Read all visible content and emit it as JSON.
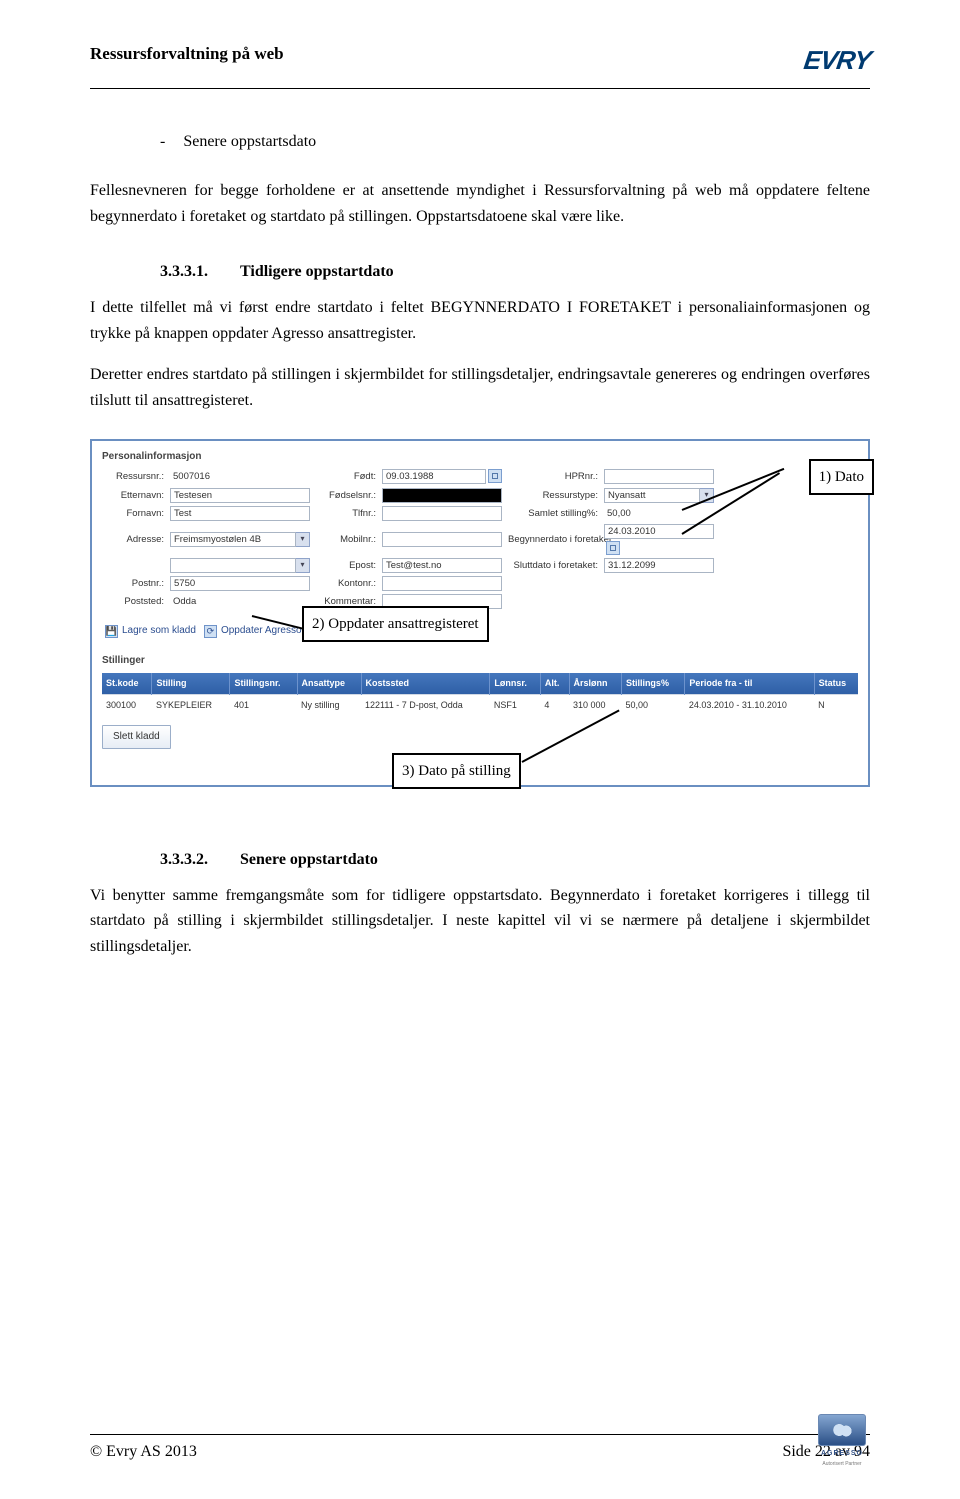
{
  "header": {
    "doc_title": "Ressursforvaltning på web",
    "logo_text": "EVRY"
  },
  "body": {
    "bullet1": "Senere oppstartsdato",
    "para1": "Fellesnevneren for begge forholdene er at ansettende myndighet i Ressursforvaltning på web må oppdatere feltene begynnerdato i foretaket og startdato på stillingen. Oppstartsdatoene skal være like.",
    "sec1_num": "3.3.3.1.",
    "sec1_title": "Tidligere oppstartdato",
    "para2": "I dette tilfellet må vi først endre startdato i feltet BEGYNNERDATO I FORETAKET i personaliainformasjonen og trykke på knappen oppdater Agresso ansattregister.",
    "para3": "Deretter endres startdato på stillingen i skjermbildet for stillingsdetaljer, endringsavtale genereres og endringen overføres tilslutt til ansattregisteret.",
    "sec2_num": "3.3.3.2.",
    "sec2_title": "Senere oppstartdato",
    "para4": "Vi benytter samme fremgangsmåte som for tidligere oppstartsdato. Begynnerdato i foretaket korrigeres i tillegg til startdato på stilling i skjermbildet stillingsdetaljer. I neste kapittel vil vi se nærmere på detaljene i skjermbildet stillingsdetaljer."
  },
  "figure": {
    "section_title": "Personalinformasjon",
    "callout1": "1)  Dato",
    "callout2": "2) Oppdater ansattregisteret",
    "callout3": "3) Dato på stilling",
    "labels": {
      "ressursnr": "Ressursnr.:",
      "etternavn": "Etternavn:",
      "fornavn": "Fornavn:",
      "adresse": "Adresse:",
      "postnr": "Postnr.:",
      "poststed": "Poststed:",
      "fodt": "Født:",
      "fodselsnr": "Fødselsnr.:",
      "tlfnr": "Tlfnr.:",
      "mobilnr": "Mobilnr.:",
      "epost": "Epost:",
      "kontonr": "Kontonr.:",
      "kommentar": "Kommentar:",
      "hprnr": "HPRnr.:",
      "ressurstype": "Ressurstype:",
      "samlet_stilling": "Samlet stilling%:",
      "begynnerdato": "Begynnerdato i foretaket:",
      "sluttdato": "Sluttdato i foretaket:"
    },
    "values": {
      "ressursnr": "5007016",
      "etternavn": "Testesen",
      "fornavn": "Test",
      "adresse": "Freimsmyostølen 4B",
      "postnr": "5750",
      "poststed": "Odda",
      "fodt": "09.03.1988",
      "epost": "Test@test.no",
      "ressurstype": "Nyansatt",
      "samlet_stilling": "50,00",
      "begynnerdato": "24.03.2010",
      "sluttdato": "31.12.2099"
    },
    "actions": {
      "lagre": "Lagre som kladd",
      "oppdater": "Oppdater Agresso ansattregister",
      "slett": "Slett kladd"
    },
    "stillinger_title": "Stillinger",
    "table": {
      "headers": [
        "St.kode",
        "Stilling",
        "Stillingsnr.",
        "Ansattype",
        "Kostssted",
        "Lønnsr.",
        "Alt.",
        "Årslønn",
        "Stillings%",
        "Periode fra - til",
        "Status"
      ],
      "row": [
        "300100",
        "SYKEPLEIER",
        "401",
        "Ny stilling",
        "122111 - 7 D-post, Odda",
        "NSF1",
        "4",
        "310 000",
        "50,00",
        "24.03.2010 - 31.10.2010",
        "N"
      ]
    }
  },
  "footer": {
    "copyright": "© Evry AS 2013",
    "page": "Side 22 av 94",
    "agresso": "AGRESSO",
    "agresso_sub": "Autorisert Partner"
  }
}
